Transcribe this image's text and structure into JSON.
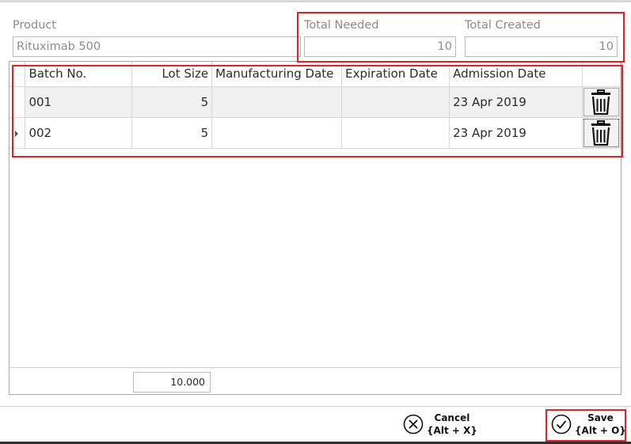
{
  "form": {
    "product_label": "Product",
    "product_value": "Rituximab 500",
    "total_needed_label": "Total Needed",
    "total_needed_value": "10",
    "total_created_label": "Total Created",
    "total_created_value": "10"
  },
  "grid": {
    "columns": [
      "Batch No.",
      "Lot Size",
      "Manufacturing Date",
      "Expiration Date",
      "Admission Date"
    ],
    "rows": [
      {
        "batch": "001",
        "lot_size": "5",
        "manufacturing_date": "",
        "expiration_date": "",
        "admission_date": "23 Apr 2019"
      },
      {
        "batch": "002",
        "lot_size": "5",
        "manufacturing_date": "",
        "expiration_date": "",
        "admission_date": "23 Apr 2019"
      }
    ],
    "lot_size_total": "10.000"
  },
  "actions": {
    "cancel_label": "Cancel",
    "cancel_shortcut": "{Alt + X}",
    "save_label": "Save",
    "save_shortcut": "{Alt + O}"
  },
  "colors": {
    "highlight": "#e0202a",
    "border": "#b9b9b9"
  },
  "icons": {
    "delete": "trash-icon",
    "cancel": "circle-x-icon",
    "save": "circle-check-icon",
    "row_indicator": "caret-right-icon"
  }
}
